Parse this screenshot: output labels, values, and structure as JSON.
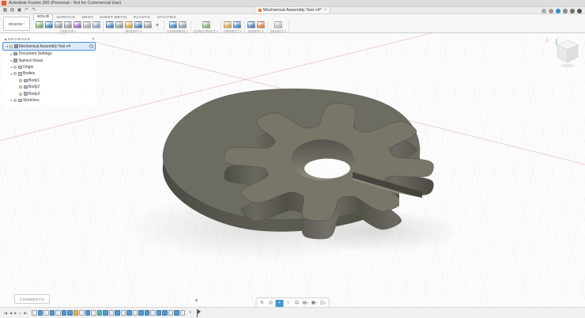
{
  "window": {
    "title": "Autodesk Fusion 360 (Personal - Not for Commercial Use)"
  },
  "quick_toolbar": {
    "icons": [
      {
        "name": "data-panel",
        "glyph": "▦"
      },
      {
        "name": "file-menu",
        "glyph": "▤"
      },
      {
        "name": "save",
        "glyph": "▣"
      },
      {
        "name": "undo",
        "glyph": "↶"
      },
      {
        "name": "redo",
        "glyph": "↷"
      }
    ]
  },
  "document_tab": {
    "label": "Mechanical Assembly Test v4*",
    "close": "×"
  },
  "top_right": {
    "icons": [
      {
        "name": "job-status",
        "c": "#ababab"
      },
      {
        "name": "extensions",
        "c": "#9b9b9b"
      },
      {
        "name": "notifications",
        "c": "#2a8fd0"
      },
      {
        "name": "help",
        "c": "#8b8b8b"
      },
      {
        "name": "preferences",
        "c": "#6f6f6f"
      },
      {
        "name": "avatar",
        "c": "#575757"
      }
    ]
  },
  "ribbon": {
    "workspace_label": "DESIGN",
    "workspace_caret": "▾",
    "tabs": [
      {
        "label": "SOLID",
        "active": true
      },
      {
        "label": "SURFACE"
      },
      {
        "label": "MESH"
      },
      {
        "label": "SHEET METAL"
      },
      {
        "label": "PLASTIC"
      },
      {
        "label": "UTILITIES"
      }
    ],
    "groups": [
      {
        "label": "CREATE",
        "icons": [
          {
            "name": "create-sketch",
            "c": "#7fae74"
          },
          {
            "name": "extrude",
            "c": "#4d86bd"
          },
          {
            "name": "revolve",
            "c": "#98a1a9"
          },
          {
            "name": "sweep",
            "c": "#98a1a9"
          },
          {
            "name": "form",
            "c": "#9d6fc3"
          },
          {
            "name": "hole",
            "c": "#aab0b5"
          },
          {
            "name": "primitive-box",
            "c": "#8fa7bd"
          }
        ]
      },
      {
        "label": "MODIFY",
        "icons": [
          {
            "name": "press-pull",
            "c": "#4d86bd"
          },
          {
            "name": "fillet",
            "c": "#98a1a9"
          },
          {
            "name": "shell",
            "c": "#d9a94c"
          },
          {
            "name": "combine",
            "c": "#4d86bd"
          },
          {
            "name": "offset-face",
            "c": "#98a1a9"
          },
          {
            "name": "move-copy",
            "glyph": "+"
          }
        ]
      },
      {
        "label": "ASSEMBLE",
        "icons": [
          {
            "name": "new-component",
            "c": "#4d86bd"
          },
          {
            "name": "joint",
            "c": "#98a1a9"
          }
        ]
      },
      {
        "label": "CONSTRUCT",
        "icons": [
          {
            "name": "construction-plane",
            "c": "#87b178"
          }
        ]
      },
      {
        "label": "INSPECT",
        "icons": [
          {
            "name": "measure",
            "c": "#d9a94c"
          },
          {
            "name": "section-analysis",
            "c": "#4d86bd"
          }
        ]
      },
      {
        "label": "INSERT",
        "icons": [
          {
            "name": "insert-derive",
            "c": "#4d86bd"
          },
          {
            "name": "decal",
            "c": "#d97f4c"
          }
        ]
      },
      {
        "label": "SELECT",
        "icons": [
          {
            "name": "select",
            "c": "#b9bfc4"
          }
        ]
      }
    ]
  },
  "browser": {
    "collapse_glyph": "◀",
    "header": "BROWSER",
    "items": [
      {
        "label": "Mechanical Assembly Test v4",
        "indent": 0,
        "arrow": "down",
        "icon": "document",
        "bulb": true,
        "root": true
      },
      {
        "label": "Document Settings",
        "indent": 1,
        "arrow": "right",
        "icon": "gear"
      },
      {
        "label": "Named Views",
        "indent": 1,
        "arrow": "right",
        "icon": "views"
      },
      {
        "label": "Origin",
        "indent": 1,
        "arrow": "right",
        "icon": "folder",
        "bulb": true
      },
      {
        "label": "Bodies",
        "indent": 1,
        "arrow": "down",
        "icon": "folder",
        "bulb": true
      },
      {
        "label": "Body1",
        "indent": 2,
        "icon": "body",
        "bulb": true
      },
      {
        "label": "Body2",
        "indent": 2,
        "icon": "body",
        "bulb": true
      },
      {
        "label": "Body3",
        "indent": 2,
        "icon": "body",
        "bulb": true
      },
      {
        "label": "Sketches",
        "indent": 1,
        "arrow": "right",
        "icon": "folder",
        "bulb": true
      }
    ]
  },
  "viewcube": {
    "home_glyph": "⌂"
  },
  "comments": {
    "label": "COMMENTS"
  },
  "nav_bar": {
    "icons": [
      {
        "name": "orbit",
        "glyph": "↻"
      },
      {
        "name": "look-at",
        "glyph": "◎"
      },
      {
        "name": "pan",
        "glyph": "+",
        "active": true
      },
      {
        "name": "zoom",
        "glyph": "○"
      },
      {
        "name": "fit",
        "glyph": "⊡"
      },
      {
        "name": "display-settings",
        "glyph": "▤",
        "caret": true
      },
      {
        "name": "grid-and-snaps",
        "glyph": "▦",
        "caret": true
      },
      {
        "name": "viewports",
        "glyph": "◫",
        "caret": true
      }
    ]
  },
  "timeline": {
    "playback": [
      {
        "name": "go-to-start",
        "glyph": "|◀"
      },
      {
        "name": "step-back",
        "glyph": "◀"
      },
      {
        "name": "play",
        "glyph": "▶"
      },
      {
        "name": "step-forward",
        "glyph": "▷"
      },
      {
        "name": "go-to-end",
        "glyph": "▶|"
      }
    ],
    "features": [
      "g",
      "b",
      "g",
      "b",
      "g",
      "b",
      "b",
      "o",
      "g",
      "b",
      "g",
      "t",
      "b",
      "g",
      "b",
      "g",
      "b",
      "g",
      "b",
      "b",
      "g",
      "b",
      "b",
      "g",
      "b",
      "g"
    ],
    "add_label": "+"
  },
  "model": {
    "description": "8-tooth gear body on teardrop cam plate",
    "gear_top_color": "#787669",
    "plate_top_color": "#6d6c63",
    "side_dark": "#56554e",
    "edge_color": "#3f3e39",
    "hole_through_color": "#fcfcfc"
  },
  "colors": {
    "accent_blue": "#0696d7",
    "canvas_bg": "#fcfcfc",
    "panel_bg": "#f2f2f2"
  }
}
